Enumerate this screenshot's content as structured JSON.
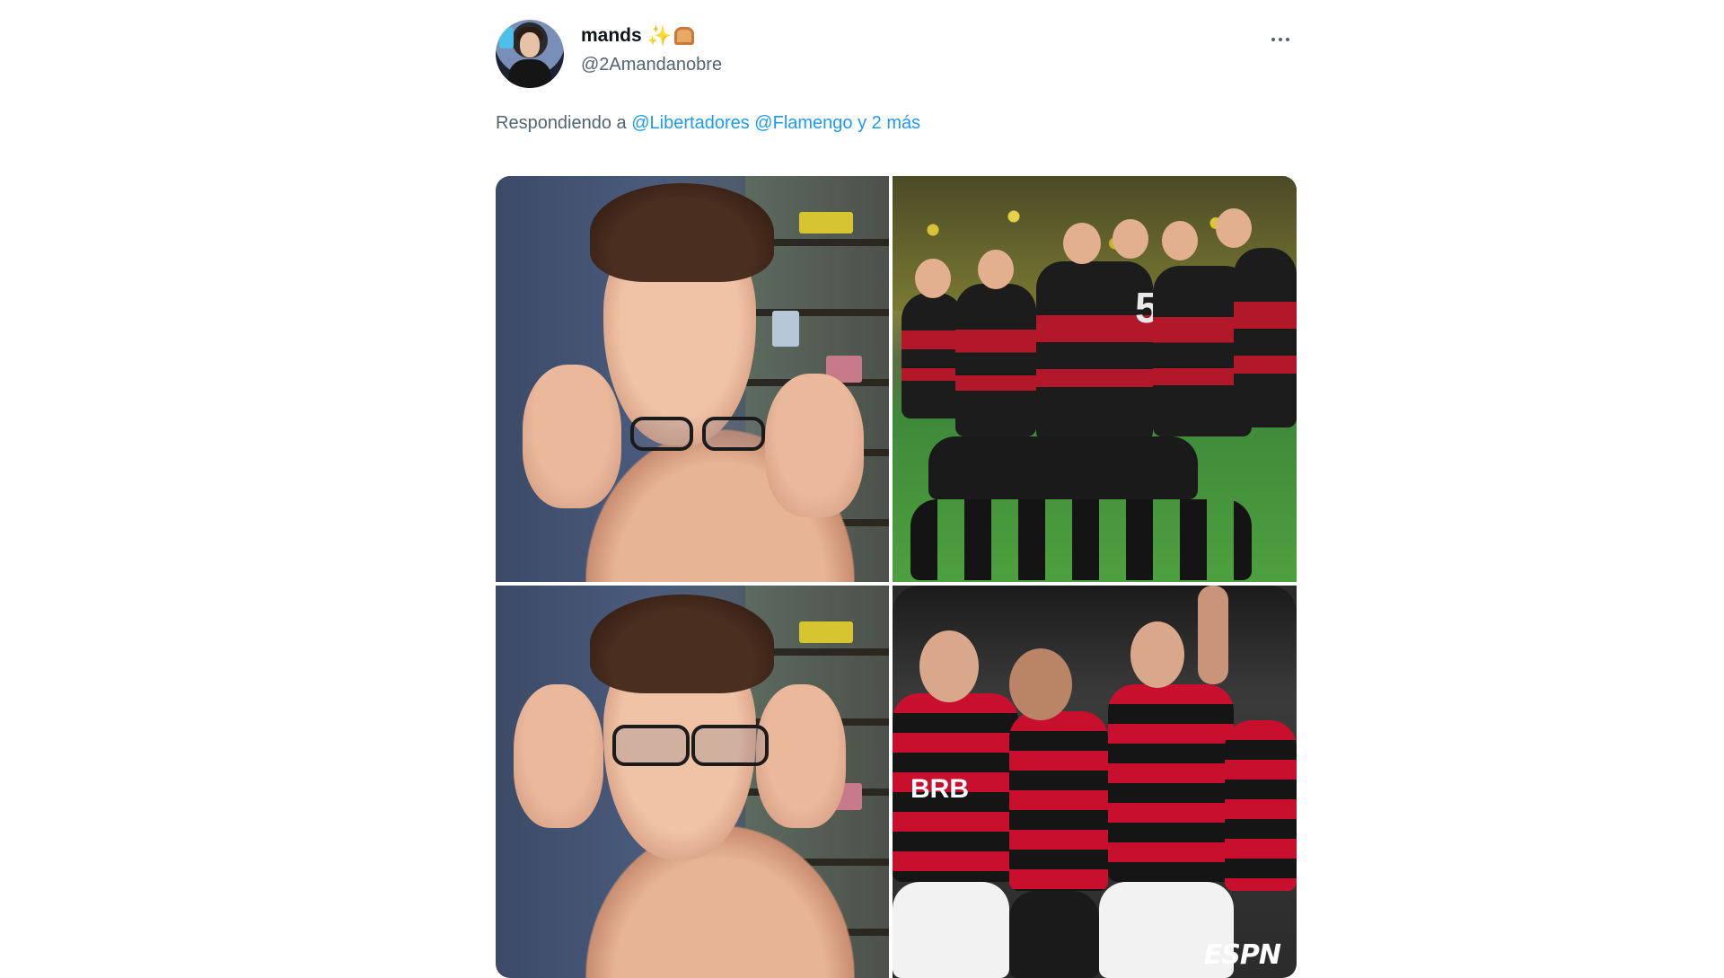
{
  "tweet": {
    "display_name": "mands",
    "handle": "@2Amandanobre",
    "name_emojis": [
      "sparkles-emoji",
      "bread-emoji"
    ],
    "reply_prefix": "Respondiendo a",
    "reply_mentions": [
      "@Libertadores",
      "@Flamengo"
    ],
    "reply_more": "y 2 más",
    "media_watermark": "ESPN",
    "media_panels": [
      {
        "name": "peter-parker-glasses-off",
        "description_icon": "meme-photo"
      },
      {
        "name": "germany-celebration",
        "description_icon": "football-photo",
        "visible_text": "5"
      },
      {
        "name": "peter-parker-glasses-on",
        "description_icon": "meme-photo"
      },
      {
        "name": "flamengo-celebration",
        "description_icon": "football-photo",
        "visible_text": "BRB"
      }
    ]
  },
  "colors": {
    "link": "#1d9bf0",
    "secondary_text": "#536471",
    "primary_text": "#0f1419"
  }
}
